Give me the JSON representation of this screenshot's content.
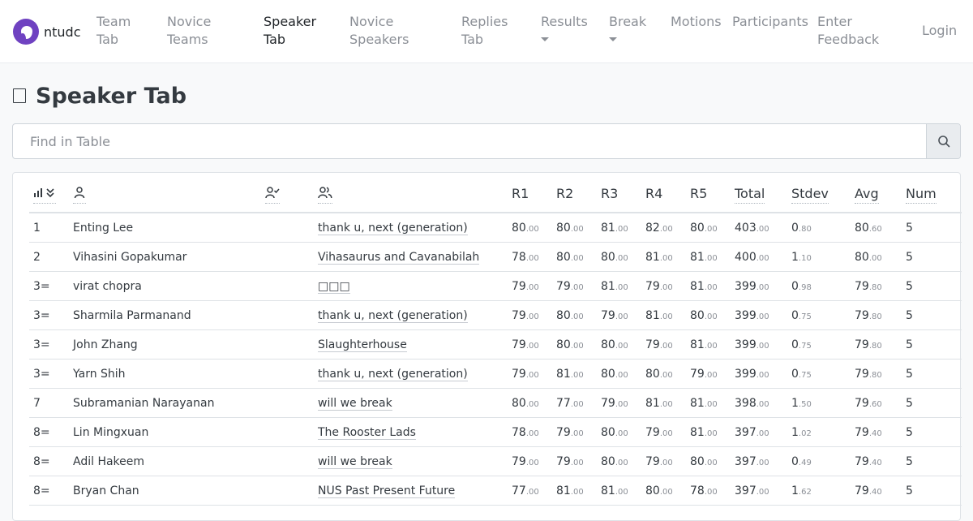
{
  "nav": {
    "brand": "ntudc",
    "items": [
      {
        "label": "Team\nTab",
        "active": false,
        "dropdown": false
      },
      {
        "label": "Novice\nTeams",
        "active": false,
        "dropdown": false
      },
      {
        "label": "Speaker\nTab",
        "active": true,
        "dropdown": false
      },
      {
        "label": "Novice\nSpeakers",
        "active": false,
        "dropdown": false
      },
      {
        "label": "Replies\nTab",
        "active": false,
        "dropdown": false
      },
      {
        "label": "Results",
        "active": false,
        "dropdown": true
      },
      {
        "label": "Break",
        "active": false,
        "dropdown": true
      },
      {
        "label": "Motions",
        "active": false,
        "dropdown": false
      },
      {
        "label": "Participants",
        "active": false,
        "dropdown": false
      },
      {
        "label": "Enter\nFeedback",
        "active": false,
        "dropdown": false
      }
    ],
    "login": "Login"
  },
  "page": {
    "title": "Speaker Tab"
  },
  "search": {
    "placeholder": "Find in Table",
    "value": ""
  },
  "table": {
    "headers": [
      "R1",
      "R2",
      "R3",
      "R4",
      "R5",
      "Total",
      "Stdev",
      "Avg",
      "Num"
    ],
    "icons": [
      "rank-sort-icon",
      "speaker-icon",
      "institution-icon",
      "team-icon"
    ],
    "rows": [
      {
        "rank": "1",
        "name": "Enting Lee",
        "team": "thank u, next (generation)",
        "scores": [
          [
            "80",
            ".00"
          ],
          [
            "80",
            ".00"
          ],
          [
            "81",
            ".00"
          ],
          [
            "82",
            ".00"
          ],
          [
            "80",
            ".00"
          ]
        ],
        "total": [
          "403",
          ".00"
        ],
        "stdev": [
          "0",
          ".80"
        ],
        "avg": [
          "80",
          ".60"
        ],
        "num": "5"
      },
      {
        "rank": "2",
        "name": "Vihasini Gopakumar",
        "team": "Vihasaurus and Cavanabilah",
        "scores": [
          [
            "78",
            ".00"
          ],
          [
            "80",
            ".00"
          ],
          [
            "80",
            ".00"
          ],
          [
            "81",
            ".00"
          ],
          [
            "81",
            ".00"
          ]
        ],
        "total": [
          "400",
          ".00"
        ],
        "stdev": [
          "1",
          ".10"
        ],
        "avg": [
          "80",
          ".00"
        ],
        "num": "5"
      },
      {
        "rank": "3=",
        "name": "virat chopra",
        "team": "□□□",
        "scores": [
          [
            "79",
            ".00"
          ],
          [
            "79",
            ".00"
          ],
          [
            "81",
            ".00"
          ],
          [
            "79",
            ".00"
          ],
          [
            "81",
            ".00"
          ]
        ],
        "total": [
          "399",
          ".00"
        ],
        "stdev": [
          "0",
          ".98"
        ],
        "avg": [
          "79",
          ".80"
        ],
        "num": "5"
      },
      {
        "rank": "3=",
        "name": "Sharmila Parmanand",
        "team": "thank u, next (generation)",
        "scores": [
          [
            "79",
            ".00"
          ],
          [
            "80",
            ".00"
          ],
          [
            "79",
            ".00"
          ],
          [
            "81",
            ".00"
          ],
          [
            "80",
            ".00"
          ]
        ],
        "total": [
          "399",
          ".00"
        ],
        "stdev": [
          "0",
          ".75"
        ],
        "avg": [
          "79",
          ".80"
        ],
        "num": "5"
      },
      {
        "rank": "3=",
        "name": "John Zhang",
        "team": "Slaughterhouse",
        "scores": [
          [
            "79",
            ".00"
          ],
          [
            "80",
            ".00"
          ],
          [
            "80",
            ".00"
          ],
          [
            "79",
            ".00"
          ],
          [
            "81",
            ".00"
          ]
        ],
        "total": [
          "399",
          ".00"
        ],
        "stdev": [
          "0",
          ".75"
        ],
        "avg": [
          "79",
          ".80"
        ],
        "num": "5"
      },
      {
        "rank": "3=",
        "name": "Yarn Shih",
        "team": "thank u, next (generation)",
        "scores": [
          [
            "79",
            ".00"
          ],
          [
            "81",
            ".00"
          ],
          [
            "80",
            ".00"
          ],
          [
            "80",
            ".00"
          ],
          [
            "79",
            ".00"
          ]
        ],
        "total": [
          "399",
          ".00"
        ],
        "stdev": [
          "0",
          ".75"
        ],
        "avg": [
          "79",
          ".80"
        ],
        "num": "5"
      },
      {
        "rank": "7",
        "name": "Subramanian Narayanan",
        "team": "will we break",
        "scores": [
          [
            "80",
            ".00"
          ],
          [
            "77",
            ".00"
          ],
          [
            "79",
            ".00"
          ],
          [
            "81",
            ".00"
          ],
          [
            "81",
            ".00"
          ]
        ],
        "total": [
          "398",
          ".00"
        ],
        "stdev": [
          "1",
          ".50"
        ],
        "avg": [
          "79",
          ".60"
        ],
        "num": "5"
      },
      {
        "rank": "8=",
        "name": "Lin Mingxuan",
        "team": "The Rooster Lads",
        "scores": [
          [
            "78",
            ".00"
          ],
          [
            "79",
            ".00"
          ],
          [
            "80",
            ".00"
          ],
          [
            "79",
            ".00"
          ],
          [
            "81",
            ".00"
          ]
        ],
        "total": [
          "397",
          ".00"
        ],
        "stdev": [
          "1",
          ".02"
        ],
        "avg": [
          "79",
          ".40"
        ],
        "num": "5"
      },
      {
        "rank": "8=",
        "name": "Adil Hakeem",
        "team": "will we break",
        "scores": [
          [
            "79",
            ".00"
          ],
          [
            "79",
            ".00"
          ],
          [
            "80",
            ".00"
          ],
          [
            "79",
            ".00"
          ],
          [
            "80",
            ".00"
          ]
        ],
        "total": [
          "397",
          ".00"
        ],
        "stdev": [
          "0",
          ".49"
        ],
        "avg": [
          "79",
          ".40"
        ],
        "num": "5"
      },
      {
        "rank": "8=",
        "name": "Bryan Chan",
        "team": "NUS Past Present Future",
        "scores": [
          [
            "77",
            ".00"
          ],
          [
            "81",
            ".00"
          ],
          [
            "81",
            ".00"
          ],
          [
            "80",
            ".00"
          ],
          [
            "78",
            ".00"
          ]
        ],
        "total": [
          "397",
          ".00"
        ],
        "stdev": [
          "1",
          ".62"
        ],
        "avg": [
          "79",
          ".40"
        ],
        "num": "5"
      }
    ]
  }
}
